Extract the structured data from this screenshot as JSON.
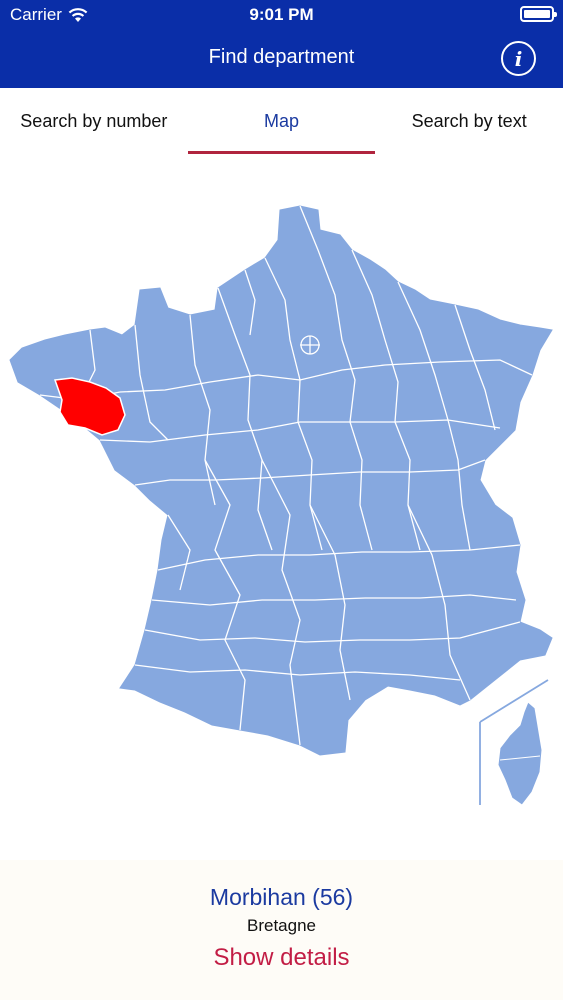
{
  "status_bar": {
    "carrier": "Carrier",
    "time": "9:01 PM"
  },
  "nav": {
    "title": "Find department",
    "info_icon": "info-icon",
    "info_glyph": "i"
  },
  "tabs": [
    {
      "label": "Search by number",
      "active": false
    },
    {
      "label": "Map",
      "active": true
    },
    {
      "label": "Search by text",
      "active": false
    }
  ],
  "map": {
    "fill_color": "#86a8df",
    "selected_color": "#ff0000",
    "border_color": "#ffffff"
  },
  "selection": {
    "department": "Morbihan (56)",
    "region": "Bretagne",
    "details_label": "Show details"
  },
  "colors": {
    "header": "#0a2ea8",
    "tab_indicator": "#b0243e",
    "link": "#c21d45",
    "accent_text": "#1b3aa0"
  }
}
